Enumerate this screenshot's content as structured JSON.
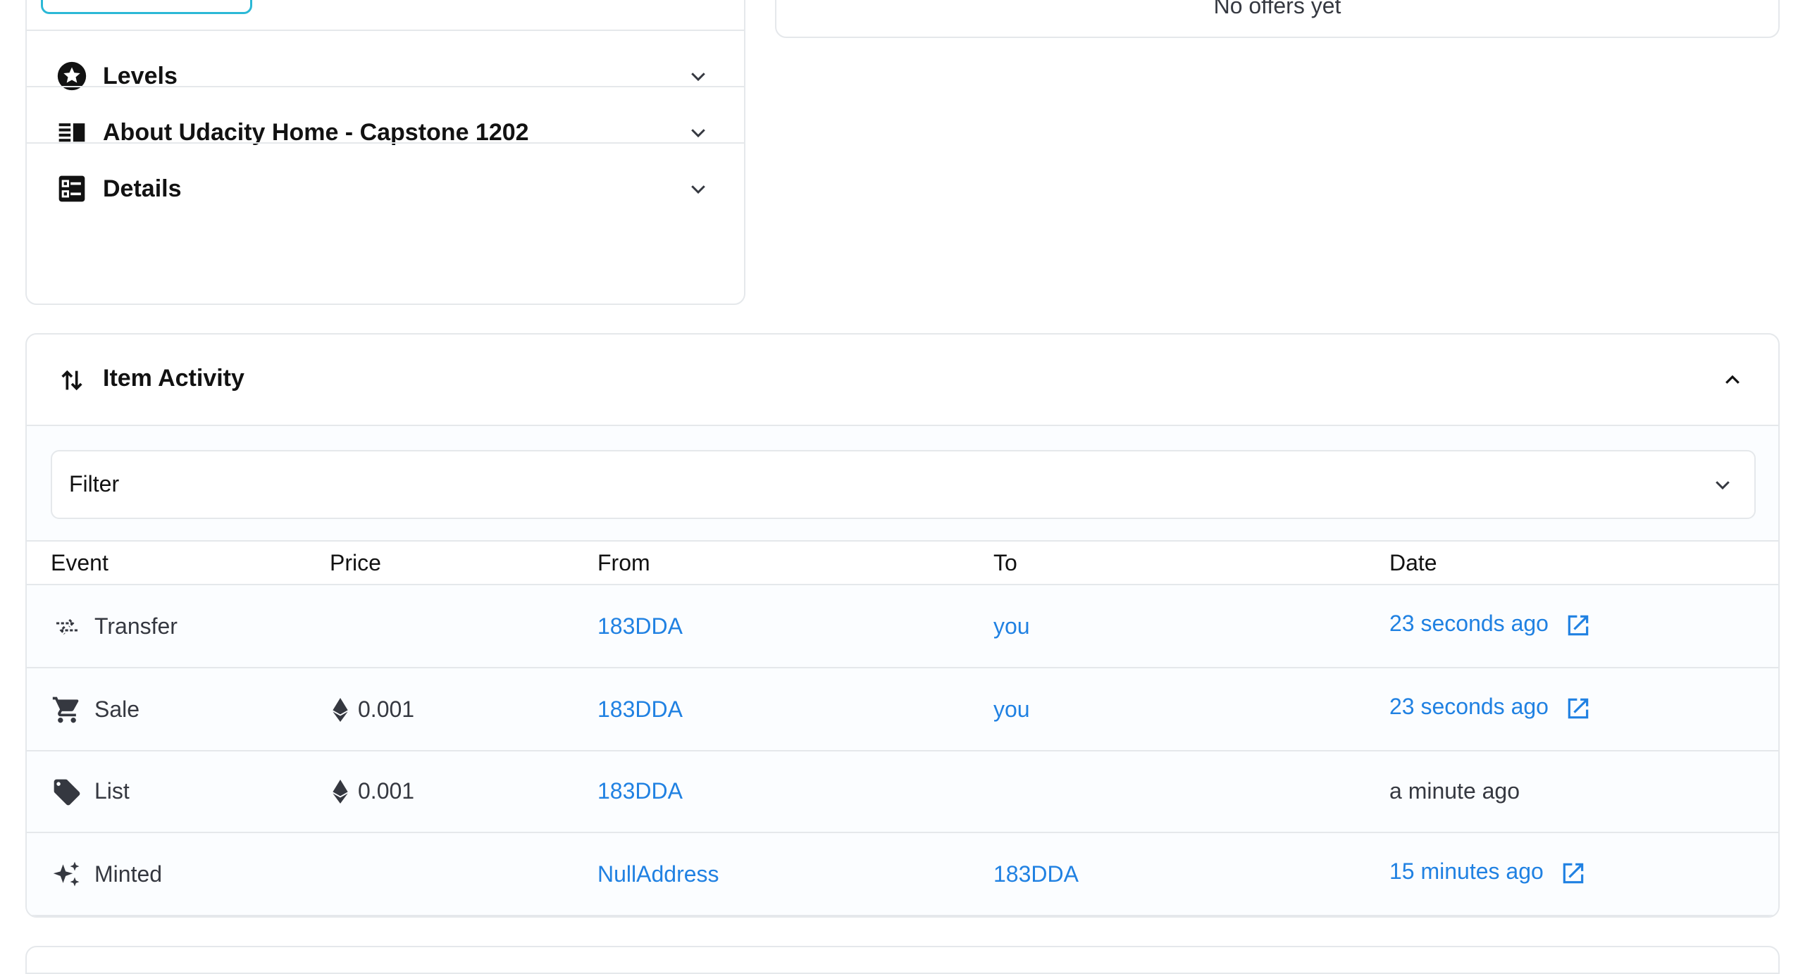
{
  "left_panel": {
    "accordions": [
      {
        "label": "Levels",
        "icon": "star-badge-icon"
      },
      {
        "label": "About Udacity Home - Capstone 1202",
        "icon": "description-icon"
      },
      {
        "label": "Details",
        "icon": "details-list-icon"
      }
    ]
  },
  "offers": {
    "empty_text": "No offers yet"
  },
  "activity": {
    "title": "Item Activity",
    "icon": "swap-vertical-icon",
    "filter_label": "Filter",
    "columns": [
      "Event",
      "Price",
      "From",
      "To",
      "Date"
    ],
    "rows": [
      {
        "event": "Transfer",
        "icon": "transfer-icon",
        "price": "",
        "from": "183DDA",
        "to": "you",
        "date": "23 seconds ago",
        "date_link": true
      },
      {
        "event": "Sale",
        "icon": "cart-icon",
        "price": "0.001",
        "from": "183DDA",
        "to": "you",
        "date": "23 seconds ago",
        "date_link": true
      },
      {
        "event": "List",
        "icon": "tag-icon",
        "price": "0.001",
        "from": "183DDA",
        "to": "",
        "date": "a minute ago",
        "date_link": false
      },
      {
        "event": "Minted",
        "icon": "sparkle-icon",
        "price": "",
        "from": "NullAddress",
        "to": "183DDA",
        "date": "15 minutes ago",
        "date_link": true
      }
    ]
  },
  "colors": {
    "link": "#2081e2",
    "border": "#e5e8eb",
    "text": "#121212",
    "accent_tab": "#2bb8d6"
  }
}
